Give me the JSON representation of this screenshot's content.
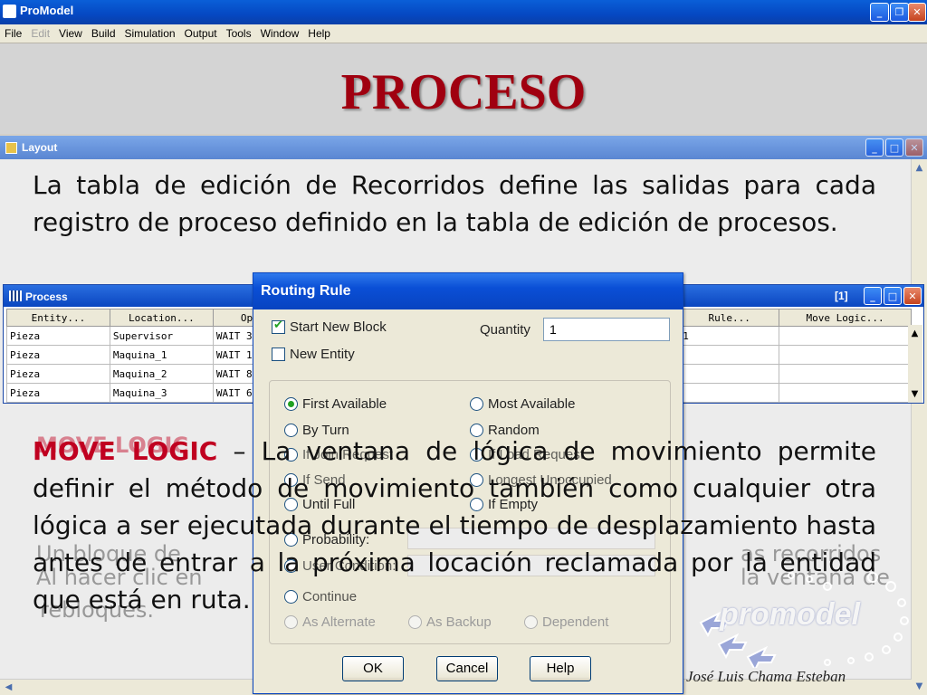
{
  "app": {
    "title": "ProModel"
  },
  "menu": [
    {
      "label": "File",
      "enabled": true
    },
    {
      "label": "Edit",
      "enabled": false
    },
    {
      "label": "View",
      "enabled": true
    },
    {
      "label": "Build",
      "enabled": true
    },
    {
      "label": "Simulation",
      "enabled": true
    },
    {
      "label": "Output",
      "enabled": true
    },
    {
      "label": "Tools",
      "enabled": true
    },
    {
      "label": "Window",
      "enabled": true
    },
    {
      "label": "Help",
      "enabled": true
    }
  ],
  "slide": {
    "title": "PROCESO",
    "para1": "La tabla de edición de Recorridos define las salidas para cada registro de proceso definido en la tabla de edición de procesos.",
    "para2_keyword": "MOVE LOGIC",
    "para2_rest": " – La ventana de lógica de movimiento permite definir el método de movimiento también como cualquier otra lógica a ser ejecutada durante el tiempo de desplazamiento hasta antes de entrar a la próxima locación reclamada por la entidad que está en ruta.",
    "author": "José Luis Chama Esteban"
  },
  "layout_window": {
    "title": "Layout"
  },
  "process_window": {
    "title": "Process",
    "counter": "[1]",
    "columns": [
      "Entity...",
      "Location...",
      "Op",
      "Rule...",
      "Move Logic..."
    ],
    "rows": [
      [
        "Pieza",
        "Supervisor",
        "WAIT 3",
        "1",
        ""
      ],
      [
        "Pieza",
        "Maquina_1",
        "WAIT 1",
        "",
        ""
      ],
      [
        "Pieza",
        "Maquina_2",
        "WAIT 8",
        "",
        ""
      ],
      [
        "Pieza",
        "Maquina_3",
        "WAIT 6",
        "",
        ""
      ]
    ]
  },
  "routing_dialog": {
    "title": "Routing Rule",
    "start_new_block": "Start New Block",
    "start_new_block_checked": true,
    "new_entity": "New Entity",
    "new_entity_checked": false,
    "quantity_label": "Quantity",
    "quantity_value": "1",
    "rules_left": [
      "First Available",
      "By Turn",
      "If Join Request",
      "If Send",
      "Until Full",
      "Probability:"
    ],
    "rules_right": [
      "Most Available",
      "Random",
      "If Load Request",
      "Longest Unoccupied",
      "If Empty"
    ],
    "selected_rule": "First Available",
    "user_condition": "User Condition:",
    "continue": "Continue",
    "bottom_options": [
      "As Alternate",
      "As Backup",
      "Dependent"
    ],
    "buttons": {
      "ok": "OK",
      "cancel": "Cancel",
      "help": "Help"
    }
  },
  "logo": {
    "text": "promodel"
  },
  "ghost_text": {
    "g1": "MOVE LOGIC",
    "g2": "Al hacer clic en",
    "g3": "Un bloque de",
    "g4": "as recorridos",
    "g5": "la ventana de",
    "g6": "rebloques."
  },
  "colors": {
    "title_red": "#a00010",
    "keyword_red": "#c00020",
    "xp_blue": "#0a46c0",
    "check_green": "#21a121"
  }
}
